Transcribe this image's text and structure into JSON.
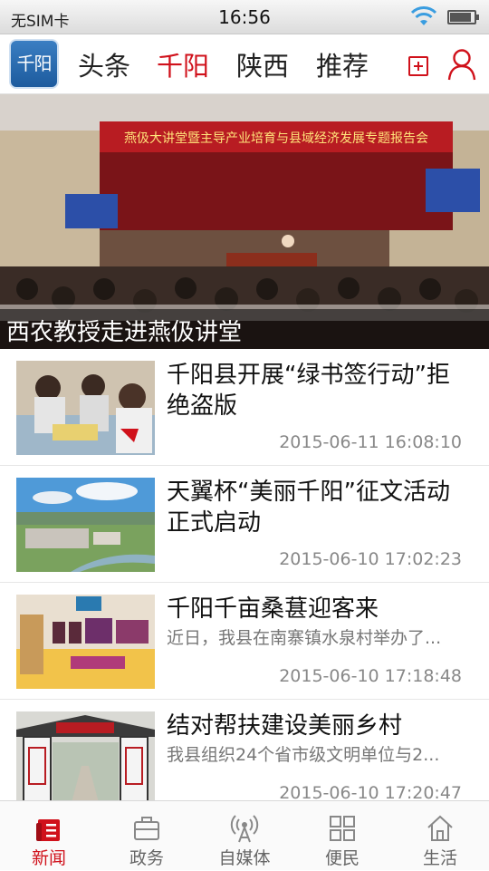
{
  "status_bar": {
    "carrier": "无SIM卡",
    "time": "16:56",
    "battery_level": 0.9
  },
  "header": {
    "logo_text": "千阳",
    "tabs": [
      {
        "label": "头条",
        "active": false
      },
      {
        "label": "千阳",
        "active": true
      },
      {
        "label": "陕西",
        "active": false
      },
      {
        "label": "推荐",
        "active": false
      }
    ],
    "accent_color": "#d0111b"
  },
  "hero": {
    "banner_text": "燕伋大讲堂暨主导产业培育与县域经济发展专题报告会",
    "caption": "西农教授走进燕伋讲堂"
  },
  "news": [
    {
      "title": "千阳县开展“绿书签行动”拒绝盗版",
      "desc": "",
      "time": "2015-06-11 16:08:10"
    },
    {
      "title": "天翼杯“美丽千阳”征文活动正式启动",
      "desc": "",
      "time": "2015-06-10 17:02:23"
    },
    {
      "title": "千阳千亩桑葚迎客来",
      "desc": "近日，我县在南寨镇水泉村举办了...",
      "time": "2015-06-10 17:18:48"
    },
    {
      "title": "结对帮扶建设美丽乡村",
      "desc": "我县组织24个省市级文明单位与2...",
      "time": "2015-06-10 17:20:47"
    }
  ],
  "bottom_nav": [
    {
      "label": "新闻",
      "icon": "news-icon",
      "active": true
    },
    {
      "label": "政务",
      "icon": "briefcase-icon",
      "active": false
    },
    {
      "label": "自媒体",
      "icon": "broadcast-icon",
      "active": false
    },
    {
      "label": "便民",
      "icon": "grid-icon",
      "active": false
    },
    {
      "label": "生活",
      "icon": "home-icon",
      "active": false
    }
  ]
}
